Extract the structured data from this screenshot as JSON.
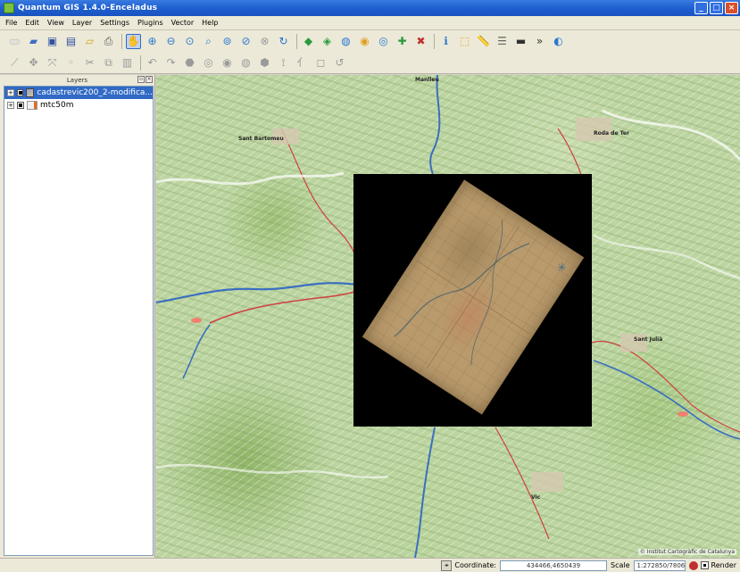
{
  "window": {
    "title": "Quantum GIS 1.4.0-Enceladus",
    "icon": "qgis-logo-icon",
    "controls": [
      "minimize",
      "maximize",
      "close"
    ]
  },
  "menu": [
    "File",
    "Edit",
    "View",
    "Layer",
    "Settings",
    "Plugins",
    "Vector",
    "Help"
  ],
  "toolbar1": {
    "icons": [
      "new-project-icon",
      "open-project-icon",
      "save-project-icon",
      "save-as-icon",
      "new-print-composer-icon",
      "print-icon",
      "pan-icon",
      "zoom-in-icon",
      "zoom-out-icon",
      "zoom-full-icon",
      "zoom-selection-icon",
      "zoom-layer-icon",
      "zoom-last-icon",
      "zoom-next-icon",
      "refresh-icon",
      "add-vector-layer-icon",
      "add-raster-layer-icon",
      "add-postgis-layer-icon",
      "add-spatialite-layer-icon",
      "add-wms-layer-icon",
      "new-vector-layer-icon",
      "remove-layer-icon",
      "identify-icon",
      "select-icon",
      "measure-icon",
      "map-tips-icon",
      "scale-bar-icon",
      "help-icon",
      "globe-icon"
    ]
  },
  "toolbar2": {
    "icons": [
      "capture-line-icon",
      "capture-polygon-icon",
      "move-feature-icon",
      "node-tool-icon",
      "cut-icon",
      "copy-icon",
      "paste-icon",
      "undo-icon",
      "redo-icon",
      "simplify-icon",
      "add-ring-icon",
      "add-part-icon",
      "delete-ring-icon",
      "delete-part-icon",
      "reshape-icon",
      "split-icon",
      "merge-icon",
      "rotate-icon"
    ]
  },
  "layers_panel": {
    "title": "Layers",
    "layers": [
      {
        "name": "cadastrevic200_2-modifica...",
        "selected": true,
        "visible": true
      },
      {
        "name": "mtc50m",
        "selected": false,
        "visible": true
      }
    ]
  },
  "map": {
    "credit": "© Institut Cartogràfic de Catalunya",
    "towns": [
      "Manlleu",
      "Sant Bartomeu",
      "Roda de Ter",
      "Sant Julià",
      "Vic"
    ]
  },
  "statusbar": {
    "coordinate_label": "Coordinate:",
    "coordinate_value": "434466,4650439",
    "scale_label": "Scale",
    "scale_value": "1:272850/7806",
    "render_label": "Render"
  },
  "colors": {
    "titlebar": "#1e5fd0",
    "selection": "#316ac5",
    "chrome": "#ece9d8",
    "map_green": "#bcd5a0",
    "river": "#3a6fc0",
    "road": "#d04040"
  }
}
